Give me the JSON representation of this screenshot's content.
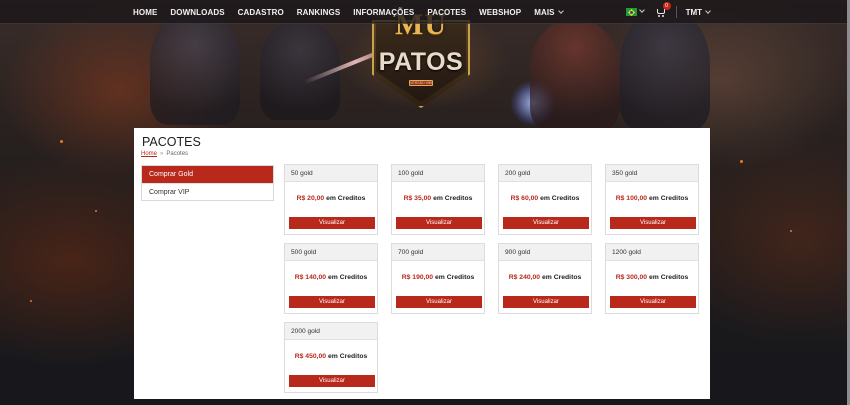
{
  "nav": {
    "items": [
      {
        "label": "HOME"
      },
      {
        "label": "DOWNLOADS"
      },
      {
        "label": "CADASTRO"
      },
      {
        "label": "RANKINGS"
      },
      {
        "label": "INFORMAÇÕES"
      },
      {
        "label": "PACOTES"
      },
      {
        "label": "WEBSHOP"
      },
      {
        "label": "MAIS"
      }
    ],
    "cart_count": "0",
    "user": "TMT"
  },
  "logo": {
    "top": "MU",
    "main": "PATOS",
    "sub": "VERSÃO 99B"
  },
  "page": {
    "title": "PACOTES",
    "breadcrumb": {
      "home": "Home",
      "separator": "»",
      "current": "Pacotes"
    }
  },
  "sidebar": {
    "items": [
      {
        "label": "Comprar Gold",
        "active": true
      },
      {
        "label": "Comprar VIP",
        "active": false
      }
    ]
  },
  "packages": {
    "unit_label": "em Creditos",
    "button_label": "Visualizar",
    "items": [
      {
        "name": "50 gold",
        "price": "R$ 20,00"
      },
      {
        "name": "100 gold",
        "price": "R$ 35,00"
      },
      {
        "name": "200 gold",
        "price": "R$ 60,00"
      },
      {
        "name": "350 gold",
        "price": "R$ 100,00"
      },
      {
        "name": "500 gold",
        "price": "R$ 140,00"
      },
      {
        "name": "700 gold",
        "price": "R$ 190,00"
      },
      {
        "name": "900 gold",
        "price": "R$ 240,00"
      },
      {
        "name": "1200 gold",
        "price": "R$ 300,00"
      },
      {
        "name": "2000 gold",
        "price": "R$ 450,00"
      }
    ]
  },
  "colors": {
    "accent": "#b8281b",
    "nav_bg": "#191618",
    "panel_bg": "#ffffff"
  }
}
